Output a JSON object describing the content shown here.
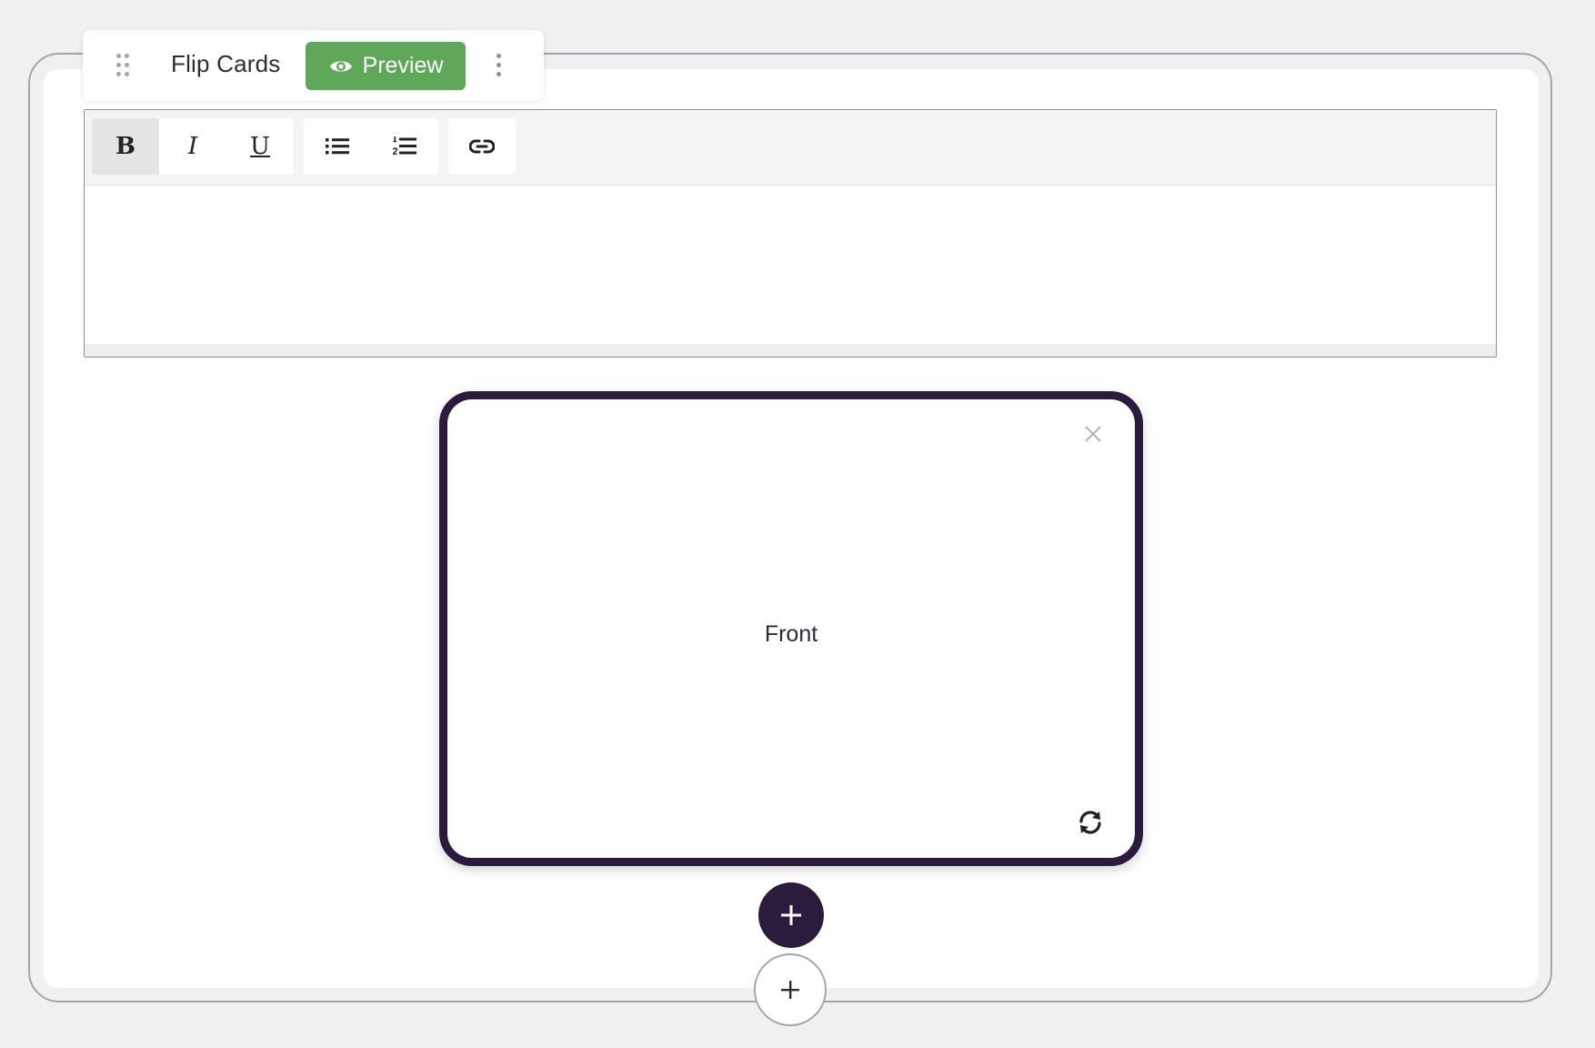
{
  "block": {
    "title": "Flip Cards",
    "preview_label": "Preview"
  },
  "editor": {
    "toolbar": {
      "bold": "B",
      "italic": "I",
      "underline": "U"
    },
    "content": ""
  },
  "card": {
    "face_label": "Front",
    "border_color": "#2b1b3d"
  },
  "colors": {
    "preview_button": "#5fa85a",
    "accent_dark": "#2b1b3d",
    "frame_border": "#a2a6ac",
    "page_background": "#f0f0f0"
  },
  "icons": {
    "drag": "drag-handle-icon",
    "preview": "eye-icon",
    "more": "more-vertical-icon",
    "bullet_list": "bulleted-list-icon",
    "numbered_list": "numbered-list-icon",
    "link": "link-icon",
    "close": "close-icon",
    "flip": "refresh-icon",
    "add": "plus-icon"
  }
}
